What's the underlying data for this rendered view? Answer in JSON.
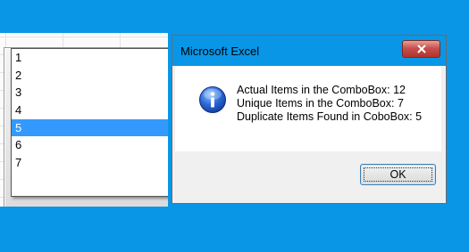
{
  "combobox": {
    "current_value": "",
    "items": [
      "1",
      "2",
      "3",
      "4",
      "5",
      "6",
      "7"
    ],
    "selected_index": 4
  },
  "dialog": {
    "title": "Microsoft Excel",
    "icon": "information-icon",
    "lines": [
      "Actual Items in the ComboBox: 12",
      "Unique Items in the ComboBox: 7",
      "Duplicate Items Found in CoboBox: 5"
    ],
    "ok_label": "OK"
  },
  "colors": {
    "background": "#0a96e6",
    "selection": "#3399ff",
    "close_button": "#c75050"
  }
}
